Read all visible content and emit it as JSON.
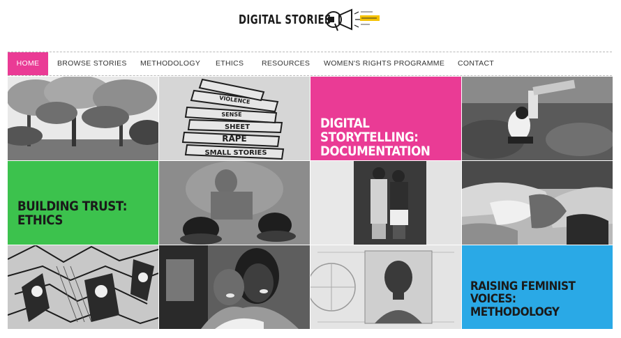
{
  "logo": {
    "title": "DIGITAL STORIES",
    "mark_icon": "megaphone-icon"
  },
  "nav": {
    "items": [
      {
        "label": "HOME",
        "active": true
      },
      {
        "label": "BROWSE STORIES",
        "active": false
      },
      {
        "label": "METHODOLOGY",
        "active": false
      },
      {
        "label": "ETHICS",
        "active": false
      },
      {
        "label": "RESOURCES",
        "active": false
      },
      {
        "label": "WOMEN'S RIGHTS PROGRAMME",
        "active": false
      },
      {
        "label": "CONTACT",
        "active": false
      }
    ],
    "active_color": "#ea3b95"
  },
  "tiles": {
    "documentation": {
      "line1": "DIGITAL STORYTELLING:",
      "line2": "DOCUMENTATION",
      "bg": "#ea3b95",
      "color": "#ffffff"
    },
    "ethics": {
      "line1": "BUILDING TRUST:",
      "line2": "ETHICS",
      "bg": "#3cc24d",
      "color": "#1a1a1a"
    },
    "methodology": {
      "line1": "RAISING FEMINIST",
      "line2": "VOICES: METHODOLOGY",
      "bg": "#2aa9e6",
      "color": "#1a1a1a"
    },
    "books_sketch": {
      "spines": [
        "SMALL STORIES",
        "RAPE",
        "SHEET",
        "SENSE",
        "VIOLENCE"
      ]
    }
  }
}
